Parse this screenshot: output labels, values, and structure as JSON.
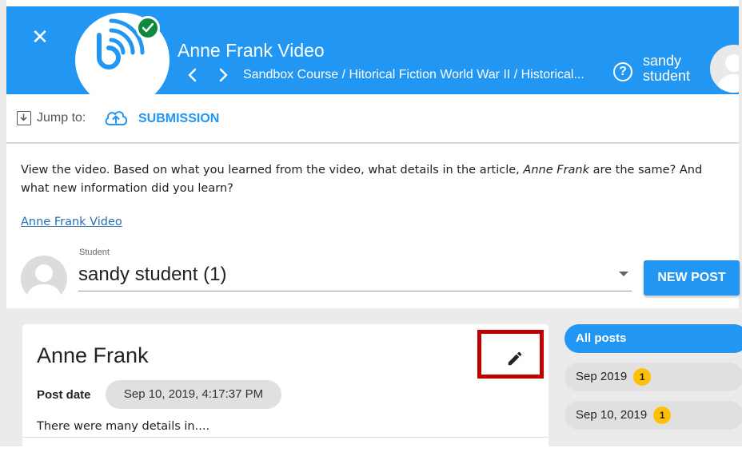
{
  "header": {
    "title": "Anne Frank Video",
    "breadcrumb": "Sandbox Course / Hitorical Fiction World War II / Historical...",
    "user_name_line1": "sandy",
    "user_name_line2": "student",
    "help_symbol": "?",
    "close_symbol": "✕",
    "brand_color": "#2196f3"
  },
  "jump": {
    "label": "Jump to:",
    "submission": "SUBMISSION"
  },
  "assignment": {
    "prompt_part1": "View the video.  Based on what you learned from the video, what details in the article, ",
    "prompt_italic": "Anne Frank",
    "prompt_part2": " are the same? And what new information did you learn?",
    "link": "Anne Frank Video"
  },
  "student": {
    "caption": "Student",
    "selected": "sandy student (1)"
  },
  "new_post_label": "NEW POST",
  "post": {
    "title": "Anne Frank",
    "date_label": "Post date",
    "date_value": "Sep 10, 2019, 4:17:37 PM",
    "body": "There were many details in...."
  },
  "filters": [
    {
      "label": "All posts",
      "active": true
    },
    {
      "label": "Sep 2019",
      "count": "1"
    },
    {
      "label": "Sep 10, 2019",
      "count": "1"
    }
  ],
  "icons": {
    "close": "close-icon",
    "logo": "app-logo-icon",
    "check": "check-badge-icon",
    "prev": "chevron-left-icon",
    "next": "chevron-right-icon",
    "help": "help-icon",
    "jump": "download-box-icon",
    "cloud": "cloud-upload-icon",
    "edit": "pencil-icon"
  },
  "colors": {
    "accent": "#2196f3",
    "success": "#0d8a3e",
    "highlight": "#c00000",
    "badge": "#ffc107"
  }
}
